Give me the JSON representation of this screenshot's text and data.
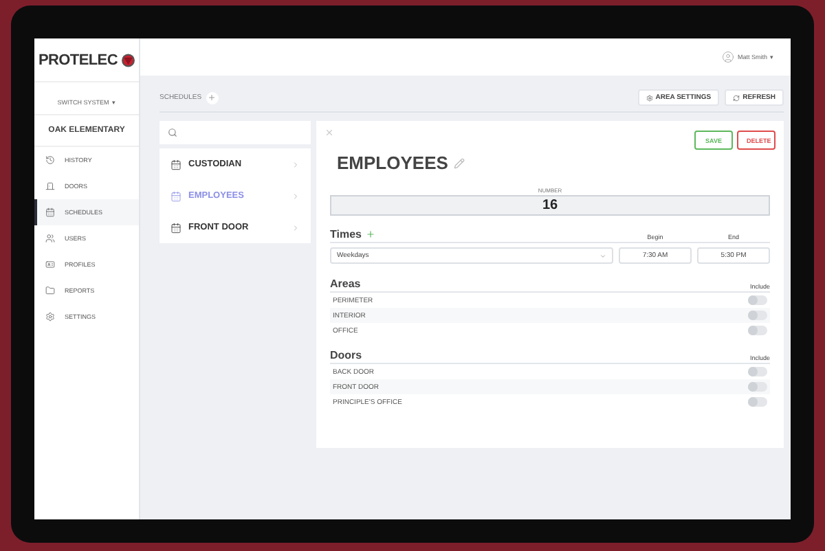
{
  "brand": {
    "name": "PROTELEC"
  },
  "user": {
    "name": "Matt Smith",
    "menu_caret": "▾"
  },
  "sidebar": {
    "system": "SWITCH SYSTEM",
    "system_caret": "▾",
    "site": "OAK ELEMENTARY",
    "items": [
      {
        "label": "HISTORY",
        "selected": false
      },
      {
        "label": "DOORS",
        "selected": false
      },
      {
        "label": "SCHEDULES",
        "selected": true
      },
      {
        "label": "USERS",
        "selected": false
      },
      {
        "label": "PROFILES",
        "selected": false
      },
      {
        "label": "REPORTS",
        "selected": false
      },
      {
        "label": "SETTINGS",
        "selected": false
      }
    ]
  },
  "toolbar": {
    "title": "SCHEDULES",
    "buttons": [
      {
        "label": "AREA SETTINGS"
      },
      {
        "label": "REFRESH"
      }
    ]
  },
  "schedules": [
    {
      "label": "CUSTODIAN",
      "selected": false
    },
    {
      "label": "EMPLOYEES",
      "selected": true
    },
    {
      "label": "FRONT DOOR",
      "selected": false
    }
  ],
  "detail": {
    "title": "EMPLOYEES",
    "save": "SAVE",
    "delete": "DELETE",
    "number_label": "NUMBER",
    "number": "16",
    "times": {
      "heading": "Times",
      "begin_label": "Begin",
      "end_label": "End",
      "rows": [
        {
          "day": "Weekdays",
          "begin": "7:30 AM",
          "end": "5:30 PM"
        }
      ]
    },
    "sections": [
      {
        "heading": "Areas",
        "include_label": "Include",
        "rows": [
          {
            "label": "PERIMETER",
            "on": false
          },
          {
            "label": "INTERIOR",
            "on": false
          },
          {
            "label": "OFFICE",
            "on": false
          }
        ]
      },
      {
        "heading": "Doors",
        "include_label": "Include",
        "rows": [
          {
            "label": "BACK DOOR",
            "on": false
          },
          {
            "label": "FRONT DOOR",
            "on": false
          },
          {
            "label": "PRINCIPLE'S OFFICE",
            "on": false
          }
        ]
      }
    ]
  }
}
